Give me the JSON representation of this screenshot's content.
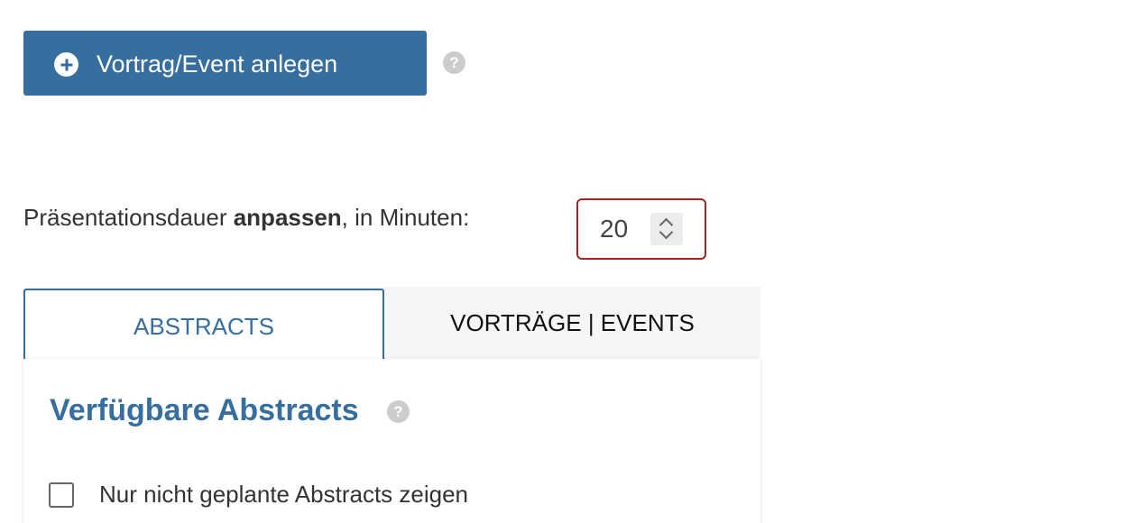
{
  "toolbar": {
    "create_label": "Vortrag/Event anlegen",
    "help_glyph": "?"
  },
  "duration": {
    "label_prefix": "Präsentationsdauer ",
    "label_bold": "anpassen",
    "label_suffix": ", in Minuten:",
    "value": "20"
  },
  "tabs": [
    {
      "label": "ABSTRACTS",
      "active": true
    },
    {
      "label": "VORTRÄGE | EVENTS",
      "active": false
    }
  ],
  "panel": {
    "title": "Verfügbare Abstracts",
    "help_glyph": "?",
    "filter_checkbox": {
      "label": "Nur nicht geplante Abstracts zeigen",
      "checked": false
    }
  },
  "colors": {
    "accent": "#356e9f",
    "invalid_border": "#a52222",
    "help_icon": "#cccccc"
  },
  "icons": {
    "create": "plus-circle-icon",
    "help": "question-circle-icon",
    "spinner": "chevron-up-down-icon"
  }
}
